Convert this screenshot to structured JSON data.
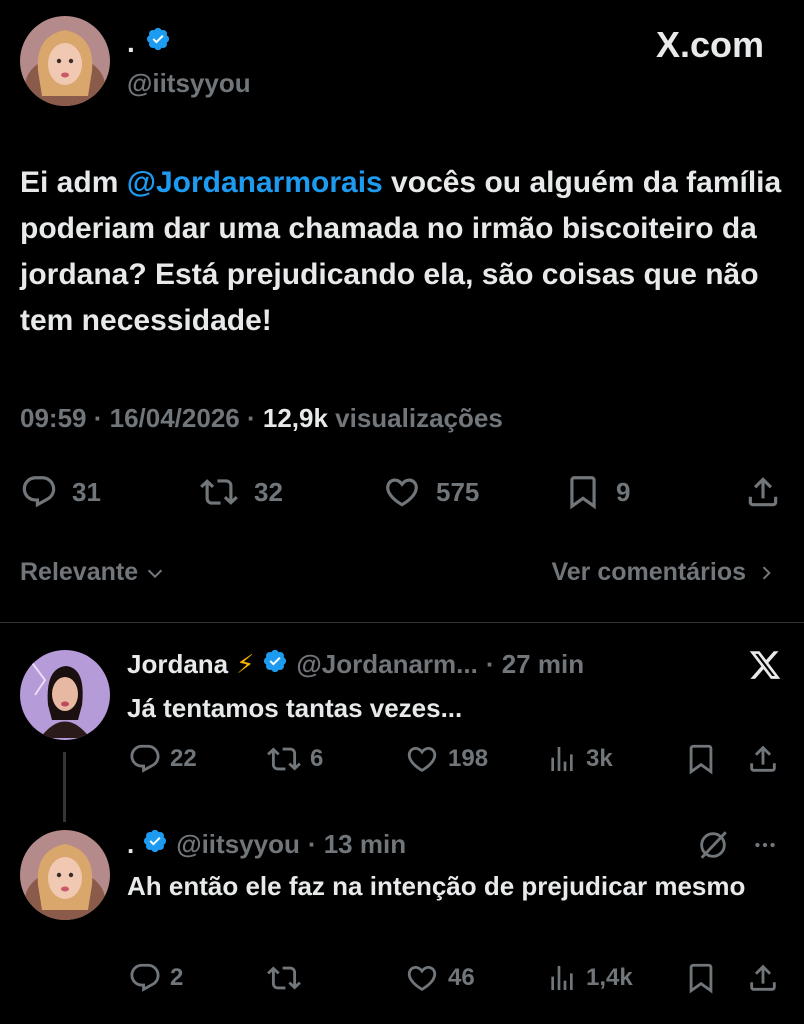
{
  "main_tweet": {
    "display_name": ".",
    "handle": "@iitsyyou",
    "brand": "X.com",
    "text_prefix": "Ei adm ",
    "mention": "@Jordanarmorais",
    "text_suffix": " vocês ou alguém da família poderiam dar uma chamada no irmão biscoiteiro da jordana? Está prejudicando ela, são coisas que não tem necessidade!",
    "time": "09:59",
    "sep1": " · ",
    "date": "16/04/2026",
    "sep2": " · ",
    "views_count": "12,9k",
    "views_label": " visualizações",
    "replies": "31",
    "reposts": "32",
    "likes": "575",
    "bookmarks": "9"
  },
  "filter": {
    "sort_label": "Relevante",
    "view_comments": "Ver comentários"
  },
  "replies": [
    {
      "display_name": "Jordana",
      "emoji": "⚡",
      "handle": "@Jordanarm...",
      "time": "· 27 min",
      "text": "Já tentamos tantas vezes...",
      "replies": "22",
      "reposts": "6",
      "likes": "198",
      "views": "3k"
    },
    {
      "display_name": ".",
      "handle": "@iitsyyou",
      "time": "· 13 min",
      "text": "Ah então ele faz na intenção de prejudicar mesmo",
      "replies": "2",
      "reposts": "",
      "likes": "46",
      "views": "1,4k"
    }
  ],
  "colors": {
    "background": "#000000",
    "text": "#e7e9ea",
    "muted": "#71767b",
    "accent": "#1d9bf0"
  }
}
